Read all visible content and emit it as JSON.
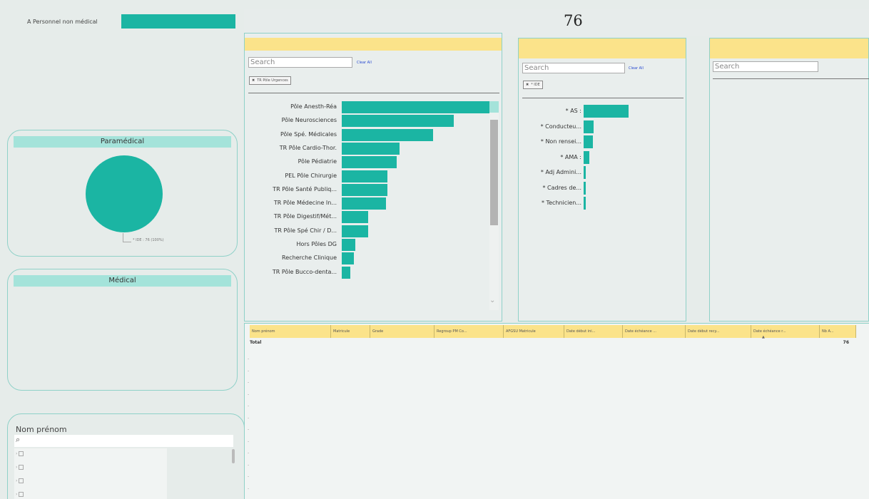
{
  "sidebar": {
    "legend_label": "A Personnel non médical",
    "card_paramedical_title": "Paramédical",
    "pie_label": "* IDE : 76 (100%)",
    "card_medical_title": "Médical",
    "slicer_title": "Nom prénom",
    "search_icon": "⌕"
  },
  "kpi": {
    "value": "76"
  },
  "panel_pole": {
    "search_placeholder": "Search",
    "clear_all": "Clear All",
    "chip": "TR Pôle Urgences",
    "bars": [
      {
        "label": "Pôle Anesth-Réa",
        "value": 100
      },
      {
        "label": "Pôle Neurosciences",
        "value": 76
      },
      {
        "label": "Pôle Spé. Médicales",
        "value": 62
      },
      {
        "label": "TR Pôle Cardio-Thor.",
        "value": 39
      },
      {
        "label": "Pôle Pédiatrie",
        "value": 37
      },
      {
        "label": "PEL Pôle Chirurgie",
        "value": 31
      },
      {
        "label": "TR Pôle Santé Publiq...",
        "value": 31
      },
      {
        "label": "TR Pôle Médecine In...",
        "value": 30
      },
      {
        "label": "TR Pôle Digestif/Mét...",
        "value": 18
      },
      {
        "label": "TR Pôle Spé Chir / D...",
        "value": 18
      },
      {
        "label": "Hors Pôles DG",
        "value": 9
      },
      {
        "label": "Recherche Clinique",
        "value": 8
      },
      {
        "label": "TR Pôle Bucco-denta...",
        "value": 6
      }
    ]
  },
  "panel_grade": {
    "search_placeholder": "Search",
    "clear_all": "Clear All",
    "chip": "* IDE",
    "bars": [
      {
        "label": "* AS :",
        "value": 100
      },
      {
        "label": "* Conducteu...",
        "value": 22
      },
      {
        "label": "* Non rensei...",
        "value": 20
      },
      {
        "label": "* AMA :",
        "value": 12
      },
      {
        "label": "* Adj Admini...",
        "value": 5
      },
      {
        "label": "* Cadres de...",
        "value": 5
      },
      {
        "label": "* Technicien...",
        "value": 5
      }
    ]
  },
  "panel_three": {
    "search_placeholder": "Search"
  },
  "table": {
    "columns": [
      "Nom prénom",
      "Matricule",
      "Grade",
      "Regroup PM Co...",
      "AFGSU Matricule",
      "Date début ini...",
      "Date échéance ...",
      "Date début recy...",
      "Date échéance r...",
      "Nb A..."
    ],
    "total_label": "Total",
    "total_value": "76"
  }
}
